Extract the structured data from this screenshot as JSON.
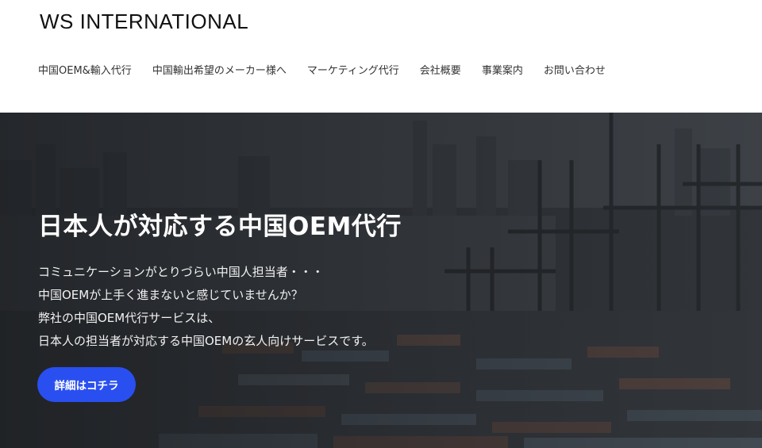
{
  "header": {
    "logo": "WS INTERNATIONAL",
    "nav": [
      {
        "label": "中国OEM&輸入代行"
      },
      {
        "label": "中国輸出希望のメーカー様へ"
      },
      {
        "label": "マーケティング代行"
      },
      {
        "label": "会社概要"
      },
      {
        "label": "事業案内"
      },
      {
        "label": "お問い合わせ"
      }
    ]
  },
  "hero": {
    "title": "日本人が対応する中国OEM代行",
    "lines": [
      "コミュニケーションがとりづらい中国人担当者・・・",
      "中国OEMが上手く進まないと感じていませんか？",
      "弊社の中国OEM代行サービスは、",
      "日本人の担当者が対応する中国OEMの玄人向けサービスです。"
    ],
    "cta_label": "詳細はコチラ",
    "background_image": "port-cranes-containers-photo"
  },
  "colors": {
    "cta": "#2a4ff0",
    "hero_overlay": "#2e3236",
    "header_bg": "#ffffff"
  }
}
